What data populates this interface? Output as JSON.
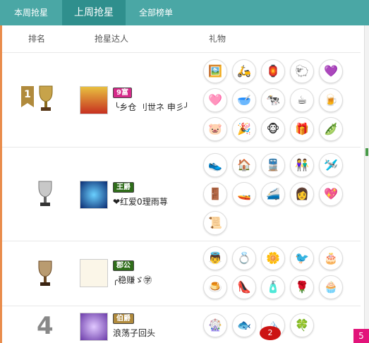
{
  "tabs": [
    {
      "label": "本周抢星"
    },
    {
      "label": "上周抢星"
    },
    {
      "label": "全部榜单"
    }
  ],
  "columns": {
    "rank": "排名",
    "user": "抢星达人",
    "gifts": "礼物"
  },
  "rows": [
    {
      "rank": "1",
      "level": "9富",
      "name": "╰乡仓 刂世ネ 申彡╯",
      "gifts": [
        "🖼️",
        "🛵",
        "🏮",
        "🐑",
        "💜",
        "🩷",
        "🥣",
        "🐄",
        "☕",
        "🍺",
        "🐷",
        "🎉",
        "🐵",
        "🎁",
        "🫛"
      ]
    },
    {
      "rank": "",
      "level": "王爵",
      "name": "❤红爱0理雨荨",
      "gifts": [
        "👟",
        "🏠",
        "🚆",
        "👫",
        "🛩️",
        "🚪",
        "🚤",
        "🚄",
        "👩",
        "💖",
        "📜"
      ]
    },
    {
      "rank": "",
      "level": "郡公",
      "name": "╭稳赚ゞ㊫",
      "gifts": [
        "👼",
        "💍",
        "🌼",
        "🐦",
        "🎂",
        "🍮",
        "👠",
        "🧴",
        "🌹",
        "🧁"
      ]
    },
    {
      "rank": "4",
      "level": "伯爵",
      "name": "浪荡子回头",
      "gifts": [
        "🎡",
        "🐟",
        "🏔️",
        "🍀"
      ]
    }
  ],
  "float_badge": "2",
  "corner_badge": "5",
  "colors": {
    "tab_bar": "#4aa7a5",
    "tab_active": "#2f8f8d",
    "level_bg": "#d62a8a"
  }
}
